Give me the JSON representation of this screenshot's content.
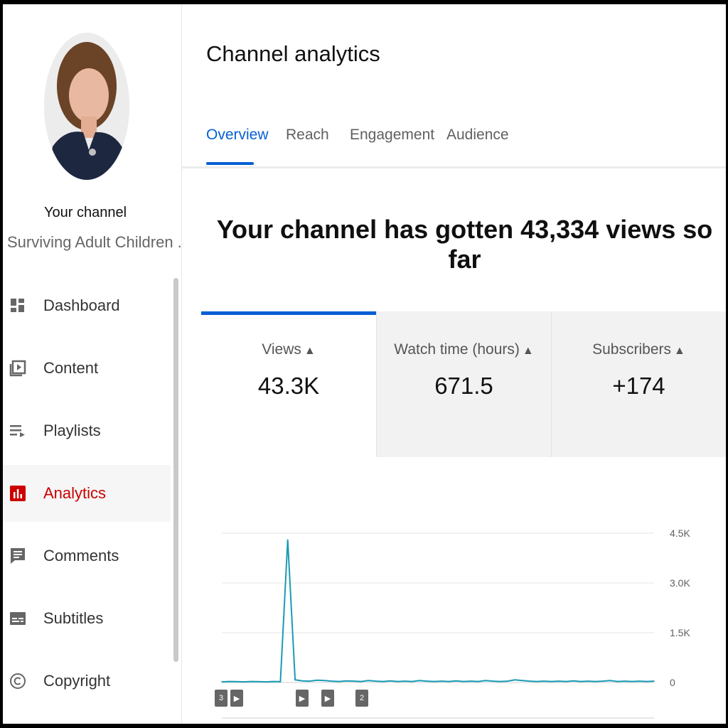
{
  "sidebar": {
    "channel_title": "Your channel",
    "channel_name": "Surviving Adult Children ...",
    "items": [
      {
        "label": "Dashboard",
        "icon": "dashboard-icon"
      },
      {
        "label": "Content",
        "icon": "content-icon"
      },
      {
        "label": "Playlists",
        "icon": "playlists-icon"
      },
      {
        "label": "Analytics",
        "icon": "analytics-icon",
        "active": true
      },
      {
        "label": "Comments",
        "icon": "comments-icon"
      },
      {
        "label": "Subtitles",
        "icon": "subtitles-icon"
      },
      {
        "label": "Copyright",
        "icon": "copyright-icon"
      }
    ]
  },
  "main": {
    "title": "Channel analytics",
    "tabs": [
      {
        "label": "Overview",
        "active": true
      },
      {
        "label": "Reach"
      },
      {
        "label": "Engagement"
      },
      {
        "label": "Audience"
      }
    ],
    "headline": "Your channel has gotten 43,334 views so far",
    "metrics": [
      {
        "label": "Views",
        "value": "43.3K",
        "active": true
      },
      {
        "label": "Watch time (hours)",
        "value": "671.5"
      },
      {
        "label": "Subscribers",
        "value": "+174"
      }
    ]
  },
  "colors": {
    "accent_blue": "#065fd4",
    "analytics_red": "#cc0000",
    "chart_line": "#1a9bb5"
  },
  "chart_data": {
    "type": "line",
    "y_ticks": [
      "4.5K",
      "3.0K",
      "1.5K",
      "0"
    ],
    "ylim": [
      0,
      4500
    ],
    "x": [
      0,
      1,
      2,
      3,
      4,
      5,
      6,
      7,
      8,
      9,
      10,
      11,
      12,
      13,
      14,
      15,
      16,
      17,
      18,
      19,
      20,
      21,
      22,
      23,
      24,
      25,
      26,
      27,
      28,
      29,
      30,
      31,
      32,
      33,
      34,
      35,
      36,
      37,
      38,
      39,
      40,
      41,
      42,
      43,
      44,
      45,
      46,
      47,
      48,
      49,
      50,
      51,
      52,
      53,
      54,
      55,
      56,
      57,
      58,
      59
    ],
    "values": [
      20,
      30,
      25,
      20,
      30,
      25,
      20,
      30,
      25,
      4300,
      80,
      50,
      40,
      70,
      60,
      40,
      30,
      50,
      40,
      30,
      60,
      40,
      30,
      50,
      30,
      40,
      30,
      60,
      40,
      30,
      40,
      30,
      50,
      30,
      40,
      30,
      60,
      40,
      30,
      40,
      80,
      60,
      40,
      30,
      40,
      30,
      40,
      30,
      50,
      30,
      40,
      30,
      40,
      60,
      30,
      40,
      30,
      40,
      30,
      40
    ],
    "grid": true
  }
}
